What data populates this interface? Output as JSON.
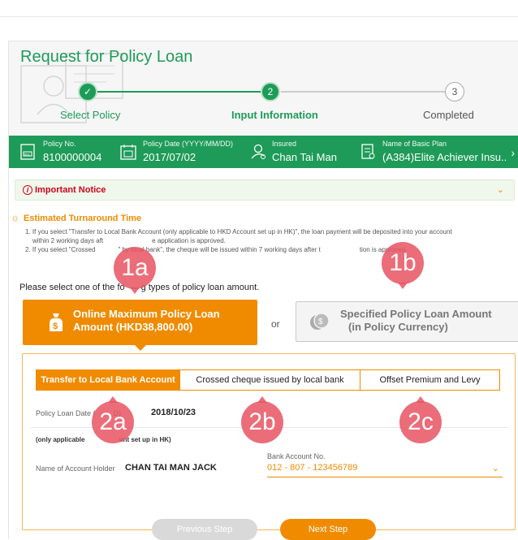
{
  "page": {
    "title": "Request for Policy Loan"
  },
  "stepper": {
    "steps": [
      {
        "label": "Select Policy",
        "number": "",
        "state": "done"
      },
      {
        "label": "Input Information",
        "number": "2",
        "state": "active"
      },
      {
        "label": "Completed",
        "number": "3",
        "state": "pending"
      }
    ]
  },
  "policy_bar": {
    "policy_no_label": "Policy No.",
    "policy_no": "8100000004",
    "policy_date_label": "Policy Date (YYYY/MM/DD)",
    "policy_date": "2017/07/02",
    "insured_label": "Insured",
    "insured": "Chan Tai Man",
    "plan_label": "Name of Basic Plan",
    "plan": "(A384)Elite Achiever Insu.."
  },
  "notice": {
    "title": "Important Notice"
  },
  "turnaround": {
    "title": "Estimated Turnaround Time",
    "lines": [
      "1. If you select \"Transfer to Local Bank Account (only applicable to HKD Account set up in HK)\", the loan payment will be deposited into your account",
      "within 2 working days aft",
      "e application is approved.",
      "2. If you select \"Crossed",
      "\" by local bank\", the cheque will be issued within 7 working days after t",
      "tion is approved."
    ]
  },
  "prompt": {
    "text_a": "Please select one of the fo",
    "text_b": "g types of policy loan amount."
  },
  "options": {
    "online_max_line1": "Online Maximum Policy Loan",
    "online_max_line2": "Amount (HKD38,800.00)",
    "or": "or",
    "specified_line1": "Specified Policy Loan Amount",
    "specified_line2": "(in Policy Currency)"
  },
  "tabs": [
    {
      "label": "Transfer to Local Bank Account"
    },
    {
      "label": "Crossed cheque issued by local bank"
    },
    {
      "label": "Offset Premium and Levy"
    }
  ],
  "form": {
    "loan_date_label_a": "Policy Loan Date (",
    "loan_date_label_b": "D)",
    "loan_date": "2018/10/23",
    "only_applicable_a": "(only applicable ",
    "only_applicable_b": "unt set up in HK)",
    "holder_label": "Name of Account Holder",
    "holder_value": "CHAN TAI MAN JACK",
    "bank_label": "Bank Account No.",
    "bank_value": "012 - 807 - 123456789"
  },
  "buttons": {
    "previous": "Previous Step",
    "next": "Next Step"
  },
  "annotations": {
    "a1a": "1a",
    "a1b": "1b",
    "a2a": "2a",
    "a2b": "2b",
    "a2c": "2c"
  },
  "colors": {
    "brand_green": "#1e9b58",
    "accent_orange": "#f08b00",
    "badge_red": "#e85461"
  }
}
